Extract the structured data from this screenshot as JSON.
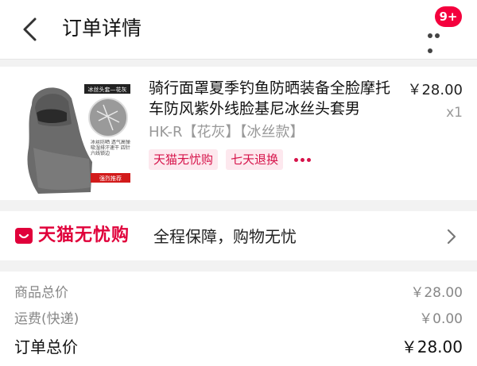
{
  "header": {
    "title": "订单详情",
    "badge": "9+"
  },
  "product": {
    "image_label_top": "冰丝头套—花灰",
    "image_label_features": "冰丝防晒 透气高弹 吸湿排汗速干 四针六线锁边",
    "image_label_recommend": "强烈推荐",
    "title": "骑行面罩夏季钓鱼防晒装备全脸摩托车防风紫外线脸基尼冰丝头套男",
    "sku": "HK-R【花灰】【冰丝款】",
    "price": "￥28.00",
    "quantity": "x1",
    "tags": [
      "天猫无忧购",
      "七天退换"
    ]
  },
  "guarantee": {
    "brand": "天猫无忧购",
    "description": "全程保障，购物无忧"
  },
  "totals": {
    "goods_label": "商品总价",
    "goods_value": "￥28.00",
    "shipping_label": "运费(快递)",
    "shipping_value": "￥0.00",
    "order_label": "订单总价",
    "order_value": "￥28.00"
  },
  "colors": {
    "accent": "#e0003a",
    "badge": "#f4003d",
    "tag_bg": "#fde8ee"
  }
}
